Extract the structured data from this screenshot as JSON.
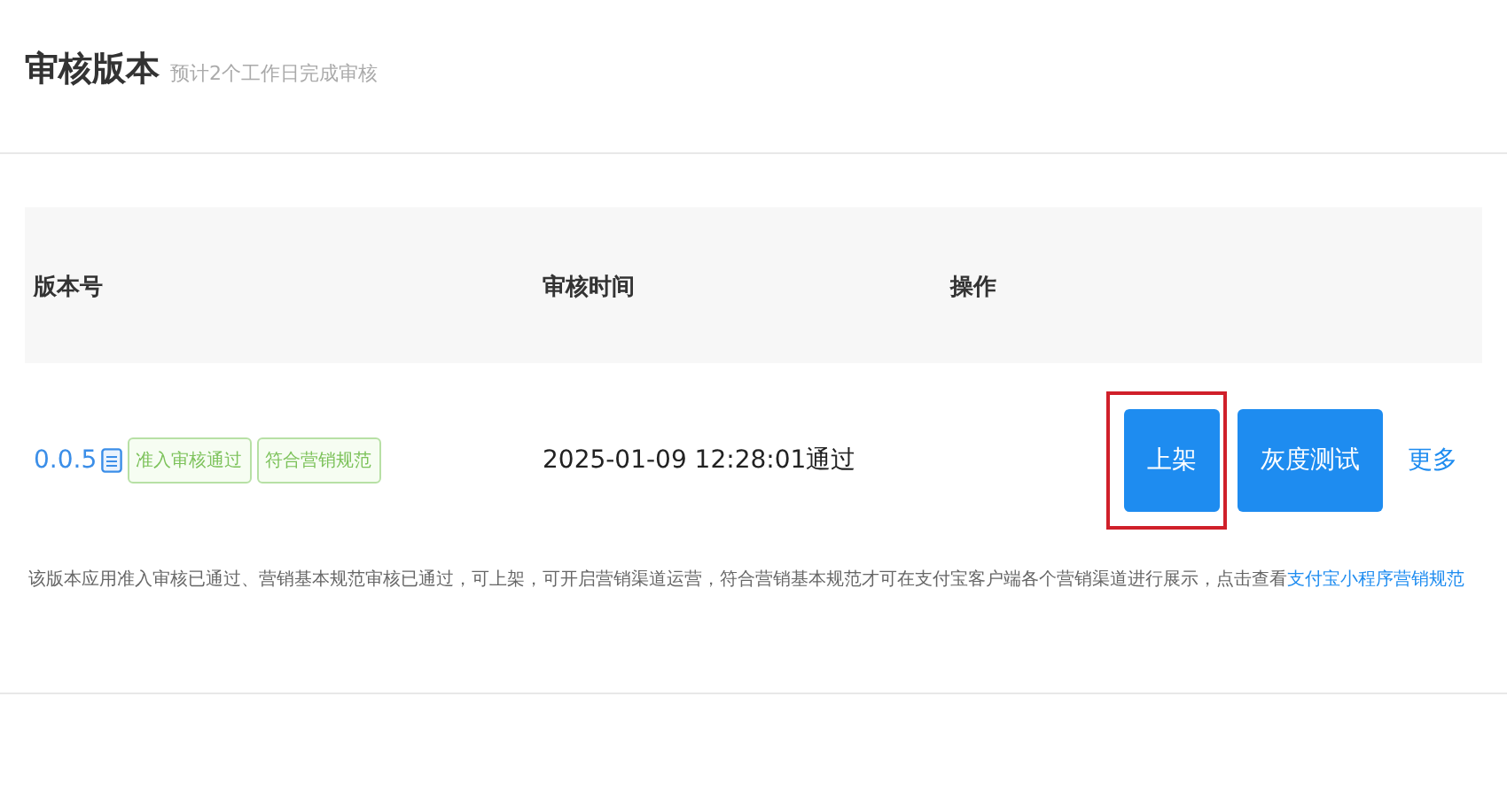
{
  "header": {
    "title": "审核版本",
    "subtitle": "预计2个工作日完成审核"
  },
  "table": {
    "columns": [
      "版本号",
      "审核时间",
      "操作"
    ],
    "rows": [
      {
        "version": "0.0.5",
        "tags": [
          "准入审核通过",
          "符合营销规范"
        ],
        "review_time": "2025-01-09 12:28:01通过",
        "actions": [
          {
            "kind": "button",
            "label": "上架",
            "highlighted": true
          },
          {
            "kind": "button",
            "label": "灰度测试",
            "highlighted": false
          },
          {
            "kind": "link",
            "label": "更多",
            "highlighted": false
          }
        ],
        "note": "该版本应用准入审核已通过、营销基本规范审核已通过，可上架，可开启营销渠道运营，符合营销基本规范才可在支付宝客户端各个营销渠道进行展示，点击查看",
        "note_link": "支付宝小程序营销规范"
      }
    ]
  }
}
